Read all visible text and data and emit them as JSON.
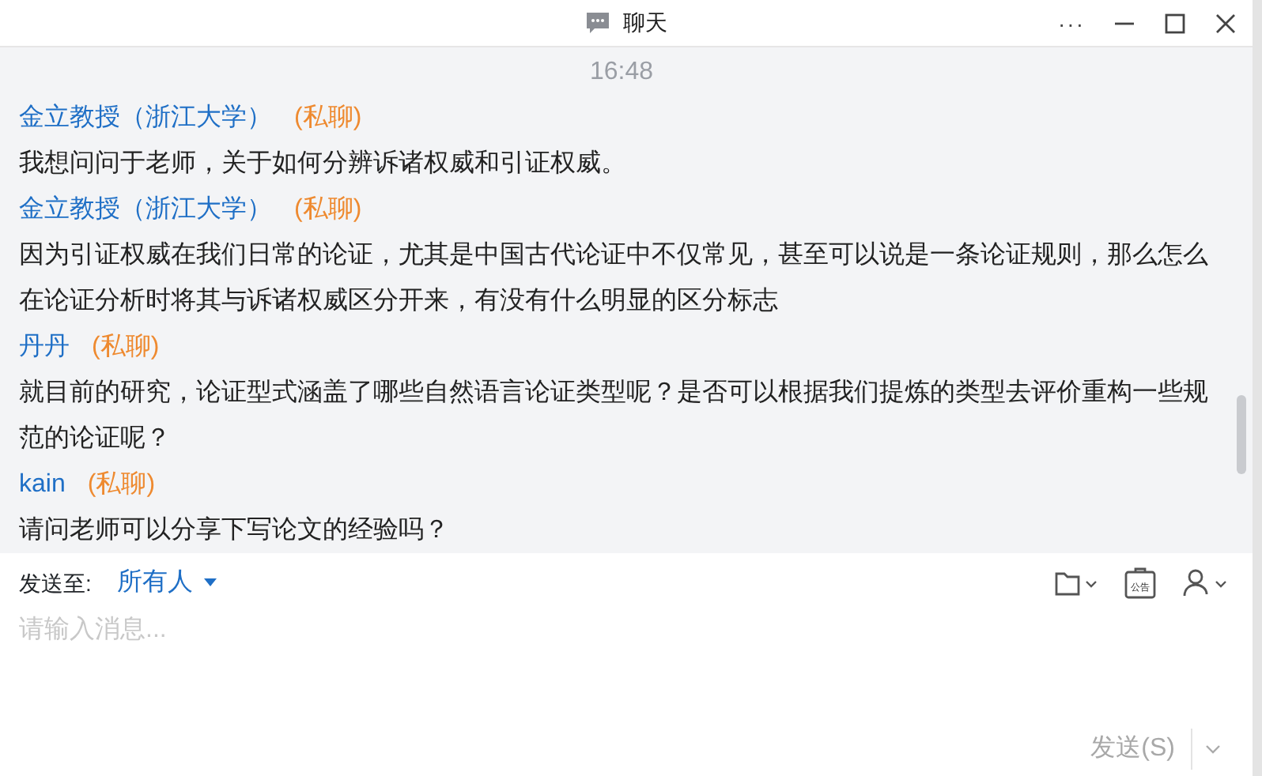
{
  "window": {
    "title": "聊天",
    "controls": [
      "···"
    ]
  },
  "time": "16:48",
  "messages": [
    {
      "sender": "金立教授（浙江大学）",
      "tag": "(私聊)",
      "text": "我想问问于老师，关于如何分辨诉诸权威和引证权威。"
    },
    {
      "sender": "金立教授（浙江大学）",
      "tag": "(私聊)",
      "text": "因为引证权威在我们日常的论证，尤其是中国古代论证中不仅常见，甚至可以说是一条论证规则，那么怎么在论证分析时将其与诉诸权威区分开来，有没有什么明显的区分标志"
    },
    {
      "sender": "丹丹",
      "tag": "(私聊)",
      "text": "就目前的研究，论证型式涵盖了哪些自然语言论证类型呢？是否可以根据我们提炼的类型去评价重构一些规范的论证呢？"
    },
    {
      "sender": "kain",
      "tag": "(私聊)",
      "text": "请问老师可以分享下写论文的经验吗？"
    }
  ],
  "composer": {
    "to_label": "发送至:",
    "recipient": "所有人",
    "placeholder": "请输入消息...",
    "notice_icon_text": "公告",
    "send": "发送(S)"
  }
}
